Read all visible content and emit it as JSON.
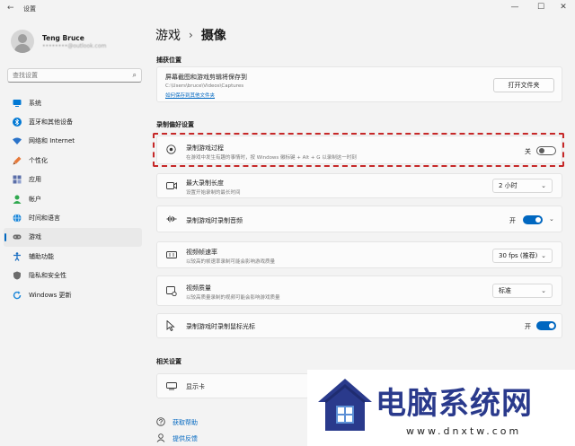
{
  "window": {
    "title": "设置",
    "back_glyph": "←",
    "controls": [
      "—",
      "☐",
      "✕"
    ]
  },
  "profile": {
    "name": "Teng Bruce",
    "email": "••••••••@outlook.com"
  },
  "search": {
    "placeholder": "查找设置"
  },
  "sidebar": {
    "items": [
      {
        "label": "系统",
        "icon": "monitor-icon",
        "color": "#0078d4"
      },
      {
        "label": "蓝牙和其他设备",
        "icon": "bluetooth-icon",
        "color": "#0078d4"
      },
      {
        "label": "网络和 Internet",
        "icon": "wifi-icon",
        "color": "#2a73c9"
      },
      {
        "label": "个性化",
        "icon": "brush-icon",
        "color": "#e6793a"
      },
      {
        "label": "应用",
        "icon": "apps-icon",
        "color": "#5a6ea8"
      },
      {
        "label": "帐户",
        "icon": "person-icon",
        "color": "#2fa84f"
      },
      {
        "label": "时间和语言",
        "icon": "globe-icon",
        "color": "#1a86d9"
      },
      {
        "label": "游戏",
        "icon": "gamepad-icon",
        "color": "#6b6b6b",
        "active": true
      },
      {
        "label": "辅助功能",
        "icon": "accessibility-icon",
        "color": "#1b6fc2"
      },
      {
        "label": "隐私和安全性",
        "icon": "shield-icon",
        "color": "#6b6b6b"
      },
      {
        "label": "Windows 更新",
        "icon": "update-icon",
        "color": "#1a86d9"
      }
    ]
  },
  "breadcrumb": {
    "parent": "游戏",
    "separator": "›",
    "current": "摄像"
  },
  "capture_location": {
    "section_title": "捕获位置",
    "title": "屏幕截图和游戏剪辑将保存到",
    "path": "C:\\Users\\bruce\\Videos\\Captures",
    "link": "如何保存到其他文件夹",
    "button": "打开文件夹"
  },
  "recording_prefs": {
    "section_title": "录制偏好设置",
    "rows": [
      {
        "title": "录制游戏过程",
        "subtitle": "在游戏中发生有趣的事情时，按 Windows 徽标键 + Alt + G 以录制这一时刻",
        "toggle": "off",
        "toggle_label": "关",
        "icon": "record-icon"
      },
      {
        "title": "最大录制长度",
        "subtitle": "设置开始录制的最长时间",
        "dropdown": "2 小时",
        "icon": "camera-icon"
      },
      {
        "title": "录制游戏时录制音频",
        "toggle": "on",
        "toggle_label": "开",
        "expand": true,
        "icon": "audio-icon"
      },
      {
        "title": "视频帧速率",
        "subtitle": "以较高的帧速率录制可能会影响游戏质量",
        "dropdown": "30 fps (推荐)",
        "icon": "framerate-icon"
      },
      {
        "title": "视频质量",
        "subtitle": "以较高质量录制的视频可能会影响游戏质量",
        "dropdown": "标准",
        "icon": "quality-icon"
      },
      {
        "title": "录制游戏时录制鼠标光标",
        "toggle": "on",
        "toggle_label": "开",
        "icon": "cursor-icon"
      }
    ]
  },
  "related": {
    "section_title": "相关设置",
    "item": "显示卡"
  },
  "help": {
    "get_help": "获取帮助",
    "feedback": "提供反馈"
  },
  "watermark": {
    "title": "电脑系统网",
    "url": "www.dnxtw.com"
  },
  "colors": {
    "accent": "#0067c0",
    "highlight_border": "#c62828",
    "watermark_blue": "#2a3a8c"
  }
}
